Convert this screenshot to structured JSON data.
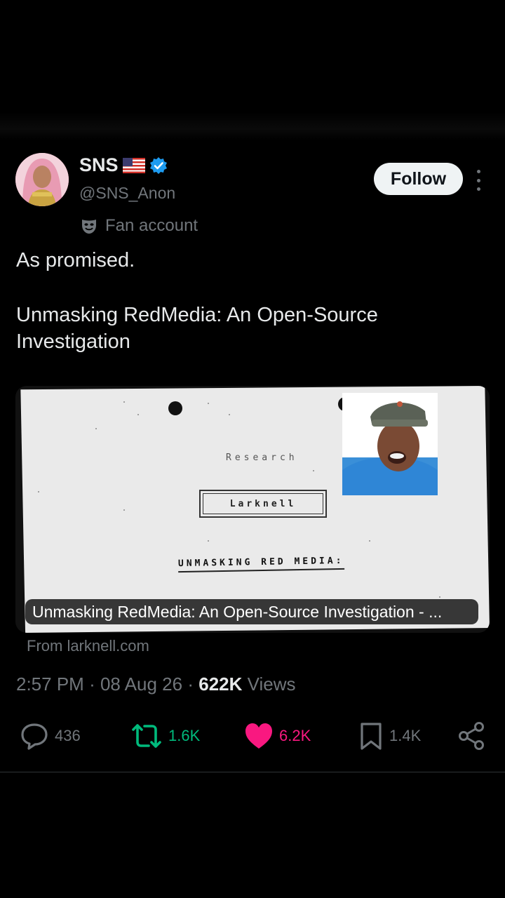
{
  "author": {
    "name": "SNS",
    "handle": "@SNS_Anon",
    "label": "Fan account"
  },
  "follow_label": "Follow",
  "tweet": {
    "line1": "As promised.",
    "line2": "Unmasking RedMedia: An Open-Source Investigation"
  },
  "card": {
    "research_label": "Research",
    "author_label": "Larknell",
    "headline": "UNMASKING RED MEDIA:",
    "caption": "Unmasking RedMedia: An Open-Source Investigation - ...",
    "source": "From larknell.com"
  },
  "meta": {
    "time": "2:57 PM",
    "sep1": "·",
    "date": "08 Aug 26",
    "sep2": "·",
    "views_count": "622K",
    "views_label": "Views"
  },
  "actions": {
    "replies": "436",
    "reposts": "1.6K",
    "likes": "6.2K",
    "bookmarks": "1.4K"
  },
  "colors": {
    "repost": "#00ba7c",
    "like": "#f91880",
    "verified": "#1d9bf0",
    "muted": "#71767b"
  },
  "icons": [
    "verified-badge-icon",
    "us-flag-icon",
    "theater-mask-icon",
    "more-icon",
    "reply-icon",
    "repost-icon",
    "like-icon",
    "bookmark-icon",
    "share-icon"
  ]
}
